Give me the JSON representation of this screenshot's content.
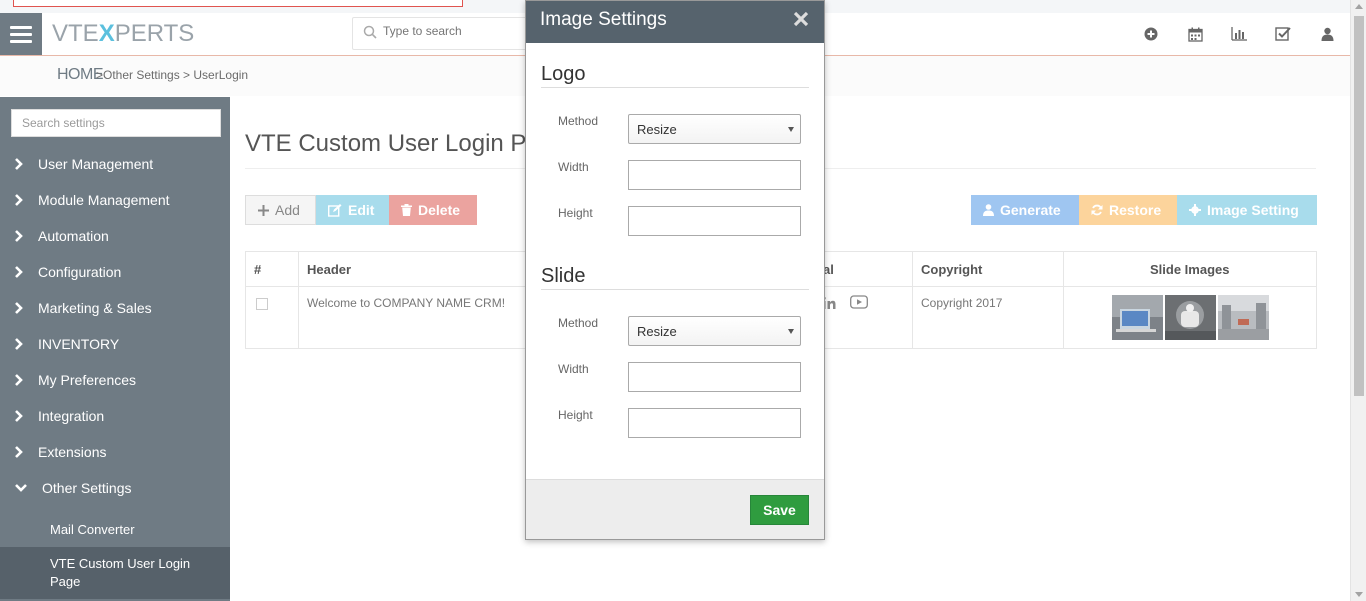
{
  "header": {
    "logo_left": "VTE",
    "logo_x": "X",
    "logo_right": "PERTS",
    "search_placeholder": "Type to search"
  },
  "breadcrumb": {
    "home": "HOME",
    "trail": ">Other Settings >  UserLogin"
  },
  "sidebar": {
    "search_placeholder": "Search settings",
    "items": [
      {
        "label": "User Management"
      },
      {
        "label": "Module Management"
      },
      {
        "label": "Automation"
      },
      {
        "label": "Configuration"
      },
      {
        "label": "Marketing & Sales"
      },
      {
        "label": "INVENTORY"
      },
      {
        "label": "My Preferences"
      },
      {
        "label": "Integration"
      },
      {
        "label": "Extensions"
      },
      {
        "label": "Other Settings"
      }
    ],
    "subitems": [
      {
        "label": "Mail Converter"
      },
      {
        "label": "VTE Custom User Login Page"
      }
    ]
  },
  "main": {
    "title": "VTE Custom User Login P",
    "buttons": {
      "add": "Add",
      "edit": "Edit",
      "delete": "Delete",
      "generate": "Generate",
      "restore": "Restore",
      "image_setting": "Image Setting"
    },
    "table": {
      "headers": {
        "num": "#",
        "header": "Header",
        "social": "al",
        "copyright": "Copyright",
        "slide_images": "Slide Images"
      },
      "rows": [
        {
          "header": "Welcome to COMPANY NAME CRM!",
          "copyright": "Copyright 2017"
        }
      ]
    }
  },
  "modal": {
    "title": "Image Settings",
    "logo_section": "Logo",
    "slide_section": "Slide",
    "labels": {
      "method": "Method",
      "width": "Width",
      "height": "Height"
    },
    "logo": {
      "method": "Resize",
      "width": "",
      "height": ""
    },
    "slide": {
      "method": "Resize",
      "width": "",
      "height": ""
    },
    "save": "Save"
  },
  "colors": {
    "sidebar": "#6f7b84",
    "modal_header": "#56636d",
    "save": "#2f9c3f",
    "edit": "#a8dcec",
    "delete": "#eba39f",
    "generate": "#9fc6f1",
    "restore": "#fcd49c"
  }
}
